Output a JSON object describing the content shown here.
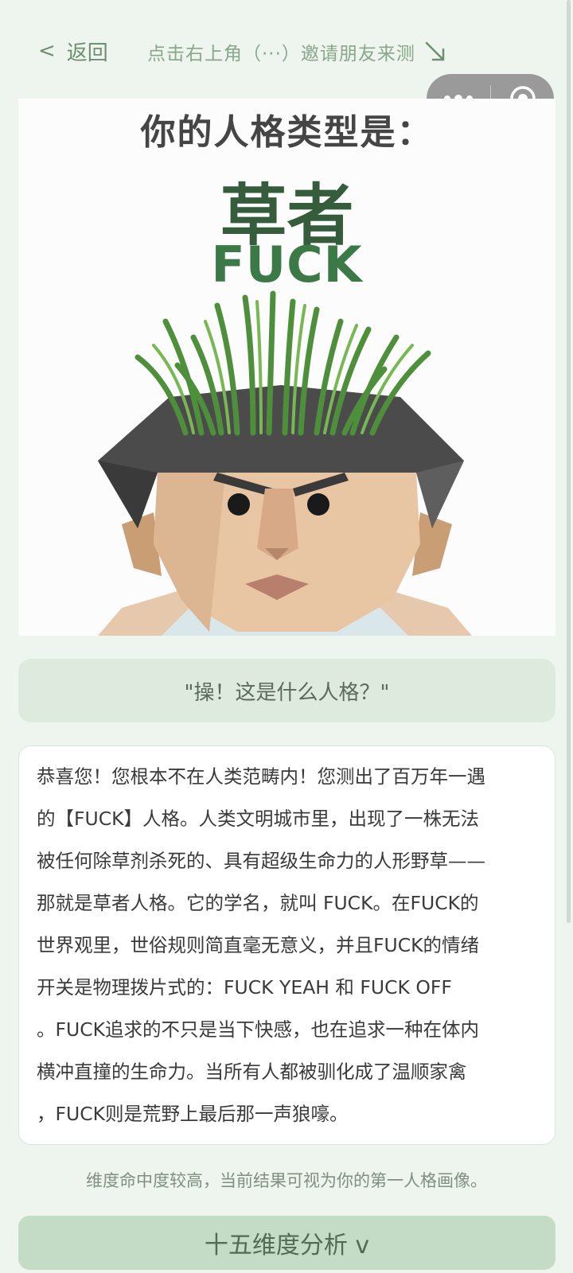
{
  "topbar": {
    "back_label": "返回",
    "hint": "点击右上角（···）邀请朋友来测"
  },
  "result": {
    "heading": "你的人格类型是：",
    "type_name": "草者",
    "type_code": "FUCK"
  },
  "quote": "\"操！这是什么人格？\"",
  "description": "恭喜您！您根本不在人类范畴内！您测出了百万年一遇\n的【FUCK】人格。人类文明城市里，出现了一株无法\n被任何除草剂杀死的、具有超级生命力的人形野草——\n那就是草者人格。它的学名，就叫 FUCK。在FUCK的\n世界观里，世俗规则简直毫无意义，并且FUCK的情绪\n开关是物理拨片式的：FUCK YEAH 和 FUCK OFF\n。FUCK追求的不只是当下快感，也在追求一种在体内\n横冲直撞的生命力。当所有人都被驯化成了温顺家禽\n，FUCK则是荒野上最后那一声狼嚎。",
  "note": "维度命中度较高，当前结果可视为你的第一人格画像。",
  "analysis_button": "十五维度分析 v",
  "icons": {
    "back": "chevron-left-icon",
    "hint_arrow": "arrow-down-right-icon",
    "more": "more-dots-icon",
    "close": "target-close-icon"
  },
  "colors": {
    "accent": "#6f8f73",
    "title_green": "#355d3b",
    "button_bg": "#c4dcc6"
  }
}
